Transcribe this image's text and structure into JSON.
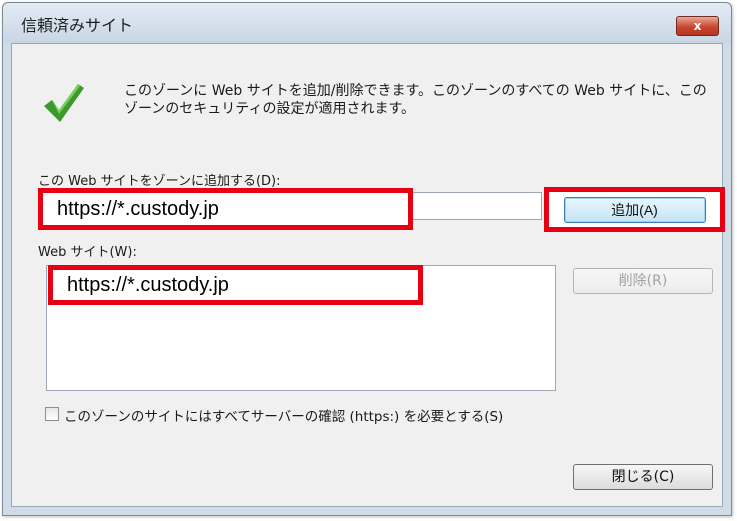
{
  "window": {
    "title": "信頼済みサイト",
    "close_label": "x"
  },
  "description": "このゾーンに Web サイトを追加/削除できます。このゾーンのすべての Web サイトに、このゾーンのセキュリティの設定が適用されます。",
  "add_section": {
    "label": "この Web サイトをゾーンに追加する(D):",
    "input_value": "https://*.custody.jp",
    "add_button": "追加(A)"
  },
  "sites_section": {
    "label": "Web サイト(W):",
    "sites": [
      "https://*.custody.jp"
    ],
    "remove_button": "削除(R)"
  },
  "https_checkbox": {
    "label": "このゾーンのサイトにはすべてサーバーの確認 (https:) を必要とする(S)",
    "checked": false
  },
  "close_button": "閉じる(C)",
  "colors": {
    "highlight_border": "#e60012",
    "check_green": "#3a9a2a"
  }
}
